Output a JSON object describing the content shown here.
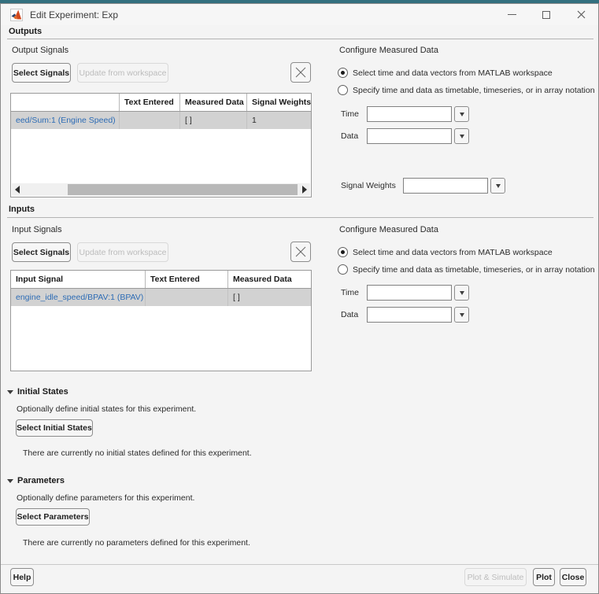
{
  "window": {
    "title": "Edit Experiment: Exp"
  },
  "outputs": {
    "heading": "Outputs",
    "signals_label": "Output Signals",
    "buttons": {
      "select_signals": "Select Signals",
      "update_from_workspace": "Update from workspace"
    },
    "table": {
      "headers": [
        "",
        "Text Entered",
        "Measured Data",
        "Signal Weights"
      ],
      "rows": [
        {
          "signal": "eed/Sum:1 (Engine Speed)",
          "text_entered": "",
          "measured_data": "[ ]",
          "signal_weights": "1"
        }
      ]
    },
    "configure": {
      "title": "Configure Measured Data",
      "radio_workspace": "Select time and data vectors from MATLAB workspace",
      "radio_array": "Specify time and data as timetable, timeseries, or in array notation",
      "time_label": "Time",
      "time_value": "",
      "data_label": "Data",
      "data_value": "",
      "signal_weights_label": "Signal Weights",
      "signal_weights_value": ""
    }
  },
  "inputs": {
    "heading": "Inputs",
    "signals_label": "Input Signals",
    "buttons": {
      "select_signals": "Select Signals",
      "update_from_workspace": "Update from workspace"
    },
    "table": {
      "headers": [
        "Input Signal",
        "Text Entered",
        "Measured Data"
      ],
      "rows": [
        {
          "signal": "engine_idle_speed/BPAV:1 (BPAV)",
          "text_entered": "",
          "measured_data": "[ ]"
        }
      ]
    },
    "configure": {
      "title": "Configure Measured Data",
      "radio_workspace": "Select time and data vectors from MATLAB workspace",
      "radio_array": "Specify time and data as timetable, timeseries, or in array notation",
      "time_label": "Time",
      "time_value": "",
      "data_label": "Data",
      "data_value": ""
    }
  },
  "initial_states": {
    "heading": "Initial States",
    "description": "Optionally define initial states for this experiment.",
    "button": "Select Initial States",
    "empty_message": "There are currently no initial states defined for this experiment."
  },
  "parameters": {
    "heading": "Parameters",
    "description": "Optionally define parameters for this experiment.",
    "button": "Select Parameters",
    "empty_message": "There are currently no parameters defined for this experiment."
  },
  "footer": {
    "help": "Help",
    "plot_simulate": "Plot & Simulate",
    "plot": "Plot",
    "close": "Close"
  },
  "colors": {
    "signal_link": "#2d6cb5",
    "selected_row_bg": "#d2d2d2",
    "desktop_strip": "#33707f",
    "window_bg": "#f4f4f4"
  }
}
